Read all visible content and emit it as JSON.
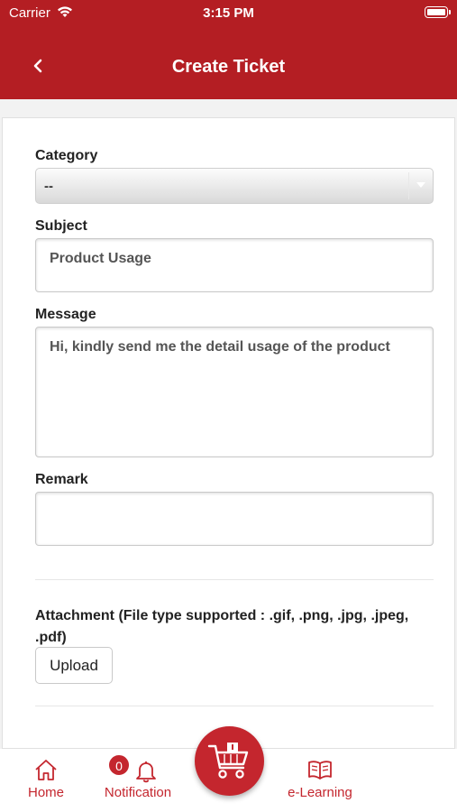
{
  "status_bar": {
    "carrier": "Carrier",
    "time": "3:15 PM",
    "wifi_icon": "wifi-icon",
    "battery_icon": "battery-icon"
  },
  "header": {
    "title": "Create Ticket",
    "back_icon": "chevron-left-icon",
    "background_color": "#b41e23"
  },
  "form": {
    "category": {
      "label": "Category",
      "value": "--",
      "dropdown_icon": "caret-down-icon"
    },
    "subject": {
      "label": "Subject",
      "value": "Product Usage"
    },
    "message": {
      "label": "Message",
      "value": "Hi, kindly send me the detail usage of the product"
    },
    "remark": {
      "label": "Remark",
      "value": ""
    },
    "attachment": {
      "label": "Attachment (File type supported : .gif, .png, .jpg, .jpeg, .pdf)",
      "upload_label": "Upload"
    }
  },
  "tabbar": {
    "accent_color": "#c4262e",
    "items": [
      {
        "label": "Home",
        "icon": "home-icon"
      },
      {
        "label": "Notification",
        "icon": "bell-icon",
        "badge": "0"
      },
      {
        "label": "",
        "icon": "cart-icon"
      },
      {
        "label": "e-Learning",
        "icon": "book-icon"
      }
    ]
  }
}
